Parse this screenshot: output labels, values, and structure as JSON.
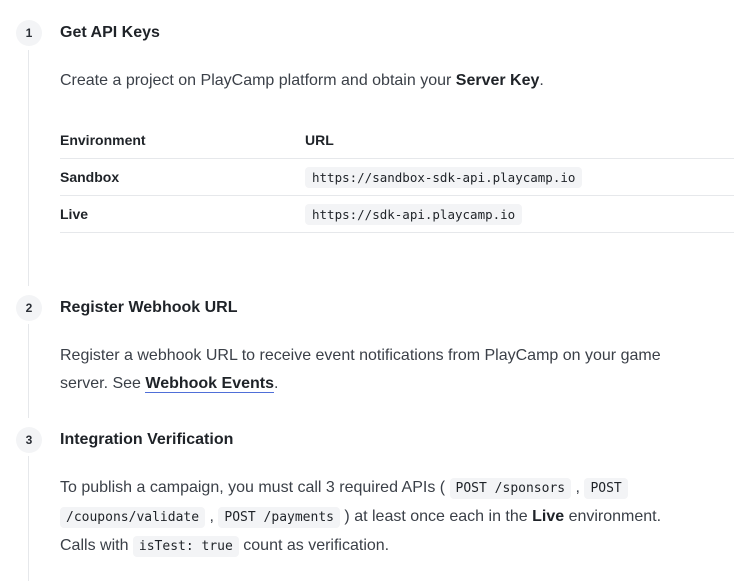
{
  "steps": [
    {
      "number": "1",
      "title": "Get API Keys",
      "text_before": "Create a project on PlayCamp platform and obtain your ",
      "strong": "Server Key",
      "text_after": ".",
      "table": {
        "headers": [
          "Environment",
          "URL"
        ],
        "rows": [
          {
            "env": "Sandbox",
            "url": "https://sandbox-sdk-api.playcamp.io"
          },
          {
            "env": "Live",
            "url": "https://sdk-api.playcamp.io"
          }
        ]
      }
    },
    {
      "number": "2",
      "title": "Register Webhook URL",
      "line1": "Register a webhook URL to receive event notifications from PlayCamp on your game",
      "line2_before": "server. See ",
      "link": "Webhook Events",
      "line2_after": "."
    },
    {
      "number": "3",
      "title": "Integration Verification",
      "t1": "To publish a campaign, you must call 3 required APIs ( ",
      "c1": "POST /sponsors",
      "t2": " , ",
      "c2a": "POST",
      "c2b": "/coupons/validate",
      "t3": " , ",
      "c3": "POST /payments",
      "t4": " ) at least once each in the ",
      "strong": "Live",
      "t5": " environment.",
      "t6": "Calls with ",
      "c4": "isTest: true",
      "t7": " count as verification."
    }
  ]
}
